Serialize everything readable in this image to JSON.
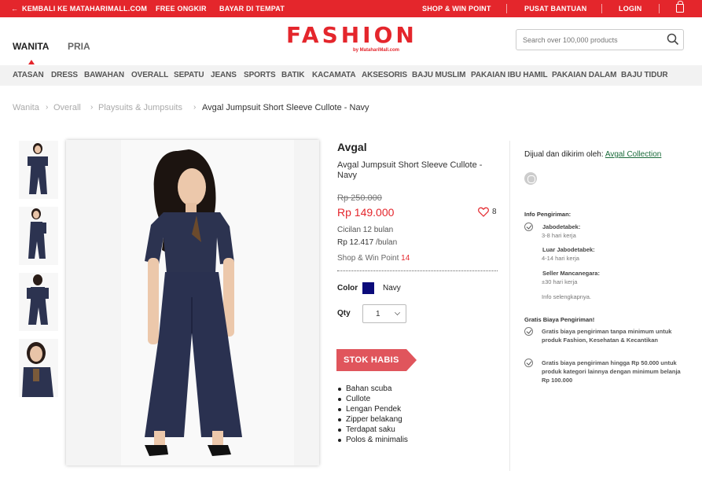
{
  "topbar": {
    "back_label": "KEMBALI KE MATAHARIMALL.COM",
    "free_shipping": "FREE ONGKIR",
    "cod": "BAYAR DI TEMPAT",
    "shop_win": "SHOP & WIN POINT",
    "help": "PUSAT BANTUAN",
    "login": "LOGIN"
  },
  "header": {
    "genders": [
      "WANITA",
      "PRIA"
    ],
    "active_gender": "WANITA",
    "logo": "FASHION",
    "logo_sub": "by MatahariMall.com",
    "search_placeholder": "Search over 100,000 products"
  },
  "categories": [
    "ATASAN",
    "DRESS",
    "BAWAHAN",
    "OVERALL",
    "SEPATU",
    "JEANS",
    "SPORTS",
    "BATIK",
    "KACAMATA",
    "AKSESORIS",
    "BAJU MUSLIM",
    "PAKAIAN IBU HAMIL",
    "PAKAIAN DALAM",
    "BAJU TIDUR"
  ],
  "breadcrumb": [
    "Wanita",
    "Overall",
    "Playsuits & Jumpsuits",
    "Avgal Jumpsuit Short Sleeve Cullote - Navy"
  ],
  "product": {
    "brand": "Avgal",
    "name": "Avgal Jumpsuit Short Sleeve Cullote - Navy",
    "old_price": "Rp 250.000",
    "price": "Rp 149.000",
    "likes": "8",
    "installment_label": "Cicilan 12 bulan",
    "installment_value": "Rp 12.417",
    "installment_unit": "/bulan",
    "win_point_label": "Shop & Win Point",
    "win_point_value": "14",
    "color_label": "Color",
    "color_name": "Navy",
    "color_hex": "#0b0b7a",
    "qty_label": "Qty",
    "qty_value": "1",
    "stock_button": "STOK HABIS",
    "features": [
      "Bahan scuba",
      "Cullote",
      "Lengan Pendek",
      "Zipper belakang",
      "Terdapat saku",
      "Polos & minimalis"
    ]
  },
  "seller": {
    "label": "Dijual dan dikirim oleh:",
    "name": "Avgal Collection"
  },
  "shipping": {
    "title": "Info Pengiriman:",
    "zones": [
      {
        "name": "Jabodetabek:",
        "time": "3-8 hari kerja"
      },
      {
        "name": "Luar Jabodetabek:",
        "time": "4-14 hari kerja"
      },
      {
        "name": "Seller Mancanegara:",
        "time": "±30 hari kerja"
      }
    ],
    "more": "Info selengkapnya.",
    "free_title": "Gratis Biaya Pengiriman!",
    "free_items": [
      "Gratis biaya pengiriman tanpa minimum untuk produk Fashion, Kesehatan & Kecantikan",
      "Gratis biaya pengiriman hingga Rp 50.000 untuk produk kategori lainnya dengan minimum belanja Rp 100.000"
    ]
  },
  "colors": {
    "brand_red": "#e4262c",
    "nav_bg": "#f2f2f2",
    "seller_link": "#1a6b3a"
  },
  "icons": [
    "back-arrow-icon",
    "bag-icon",
    "search-icon",
    "heart-icon",
    "chevron-down-icon",
    "seller-badge-icon",
    "check-circle-icon"
  ]
}
